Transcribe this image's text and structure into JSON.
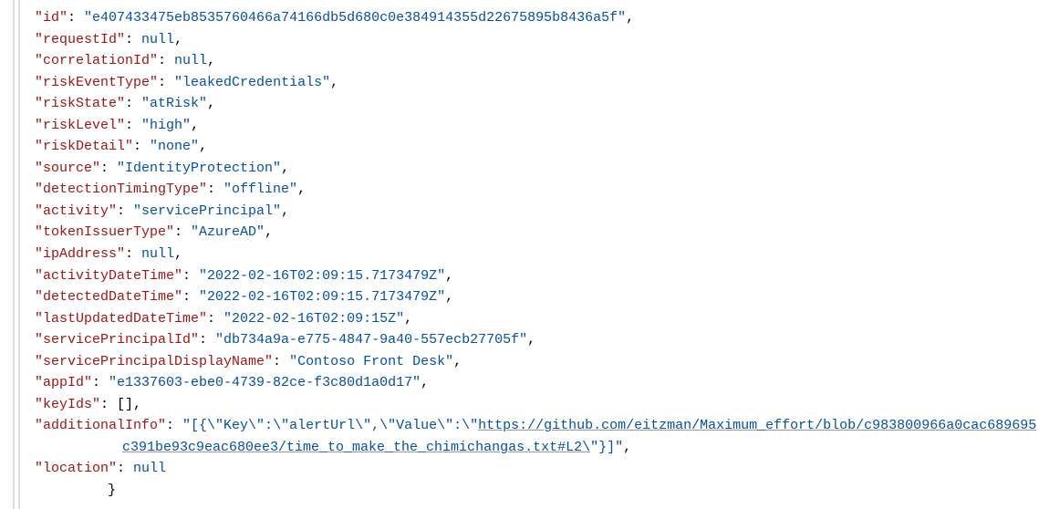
{
  "json": {
    "fields": [
      {
        "key": "id",
        "type": "string",
        "value": "e407433475eb8535760466a74166db5d680c0e384914355d22675895b8436a5f",
        "comma": true
      },
      {
        "key": "requestId",
        "type": "null",
        "value": "null",
        "comma": true
      },
      {
        "key": "correlationId",
        "type": "null",
        "value": "null",
        "comma": true
      },
      {
        "key": "riskEventType",
        "type": "string",
        "value": "leakedCredentials",
        "comma": true
      },
      {
        "key": "riskState",
        "type": "string",
        "value": "atRisk",
        "comma": true
      },
      {
        "key": "riskLevel",
        "type": "string",
        "value": "high",
        "comma": true
      },
      {
        "key": "riskDetail",
        "type": "string",
        "value": "none",
        "comma": true
      },
      {
        "key": "source",
        "type": "string",
        "value": "IdentityProtection",
        "comma": true
      },
      {
        "key": "detectionTimingType",
        "type": "string",
        "value": "offline",
        "comma": true
      },
      {
        "key": "activity",
        "type": "string",
        "value": "servicePrincipal",
        "comma": true
      },
      {
        "key": "tokenIssuerType",
        "type": "string",
        "value": "AzureAD",
        "comma": true
      },
      {
        "key": "ipAddress",
        "type": "null",
        "value": "null",
        "comma": true
      },
      {
        "key": "activityDateTime",
        "type": "string",
        "value": "2022-02-16T02:09:15.7173479Z",
        "comma": true
      },
      {
        "key": "detectedDateTime",
        "type": "string",
        "value": "2022-02-16T02:09:15.7173479Z",
        "comma": true
      },
      {
        "key": "lastUpdatedDateTime",
        "type": "string",
        "value": "2022-02-16T02:09:15Z",
        "comma": true
      },
      {
        "key": "servicePrincipalId",
        "type": "string",
        "value": "db734a9a-e775-4847-9a40-557ecb27705f",
        "comma": true
      },
      {
        "key": "servicePrincipalDisplayName",
        "type": "string",
        "value": "Contoso Front Desk",
        "comma": true
      },
      {
        "key": "appId",
        "type": "string",
        "value": "e1337603-ebe0-4739-82ce-f3c80d1a0d17",
        "comma": true
      },
      {
        "key": "keyIds",
        "type": "array",
        "value": "[]",
        "comma": true
      },
      {
        "key": "additionalInfo",
        "type": "linkstring",
        "prefix": "[{\\\"Key\\\":\\\"alertUrl\\\",\\\"Value\\\":\\\"",
        "link": "https://github.com/eitzman/Maximum_effort/blob/c983800966a0cac689695c391be93c9eac680ee3/time_to_make_the_chimichangas.txt#L2\\",
        "suffix": "\"}]",
        "comma": true
      },
      {
        "key": "location",
        "type": "null",
        "value": "null",
        "comma": false
      }
    ],
    "closingBrace": "}"
  }
}
